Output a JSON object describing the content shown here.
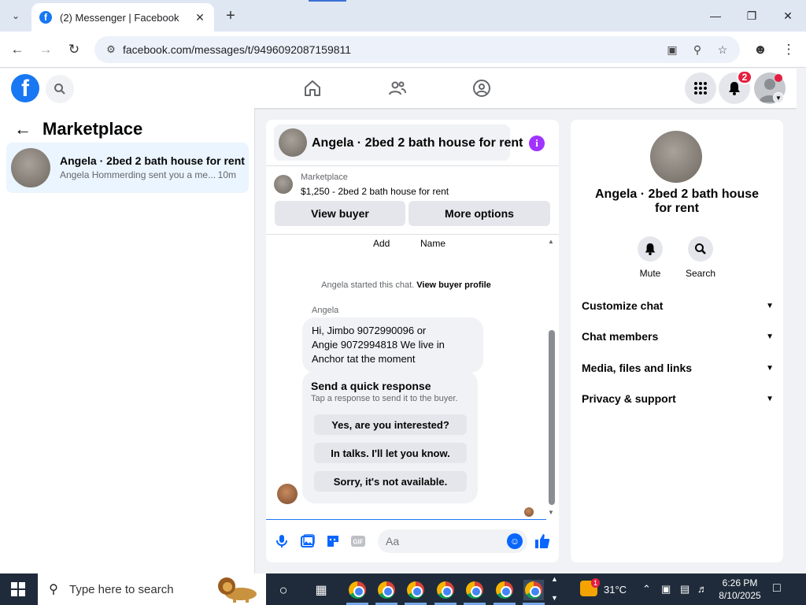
{
  "browser": {
    "tab_title": "(2) Messenger | Facebook",
    "url": "facebook.com/messages/t/9496092087159811"
  },
  "fb_header": {
    "logo_letter": "f",
    "notification_count": "2"
  },
  "left_panel": {
    "title": "Marketplace",
    "conversation": {
      "name": "Angela · 2bed 2 bath house for rent",
      "preview": "Angela Hommerding sent you a me...",
      "time": "10m"
    }
  },
  "chat": {
    "title": "Angela · 2bed 2 bath house for rent",
    "listing_label": "Marketplace",
    "listing_price": "$1,250 - 2bed 2 bath house for rent",
    "view_buyer_label": "View buyer",
    "more_options_label": "More options",
    "col_add": "Add",
    "col_name": "Name",
    "started_text": "Angela started this chat.",
    "started_link": "View buyer profile",
    "sender_name": "Angela",
    "message_lines": [
      "Hi, Jimbo 9072990096 or",
      "Angie 9072994818  We live in",
      "Anchor tat the moment"
    ],
    "quick_title": "Send a quick response",
    "quick_sub": "Tap a response to send it to the buyer.",
    "quick_responses": [
      "Yes, are you interested?",
      "In talks. I'll let you know.",
      "Sorry, it's not available."
    ],
    "composer_placeholder": "Aa"
  },
  "right_panel": {
    "title": "Angela · 2bed 2 bath house for rent",
    "mute_label": "Mute",
    "search_label": "Search",
    "sections": [
      "Customize chat",
      "Chat members",
      "Media, files and links",
      "Privacy & support"
    ]
  },
  "taskbar": {
    "search_placeholder": "Type here to search",
    "weather_badge": "1",
    "temperature": "31°C",
    "time": "6:26 PM",
    "date": "8/10/2025"
  },
  "colors": {
    "brand": "#1877f2",
    "messenger_blue": "#0866ff",
    "notification_red": "#e41e3f",
    "info_purple": "#a033ff"
  }
}
